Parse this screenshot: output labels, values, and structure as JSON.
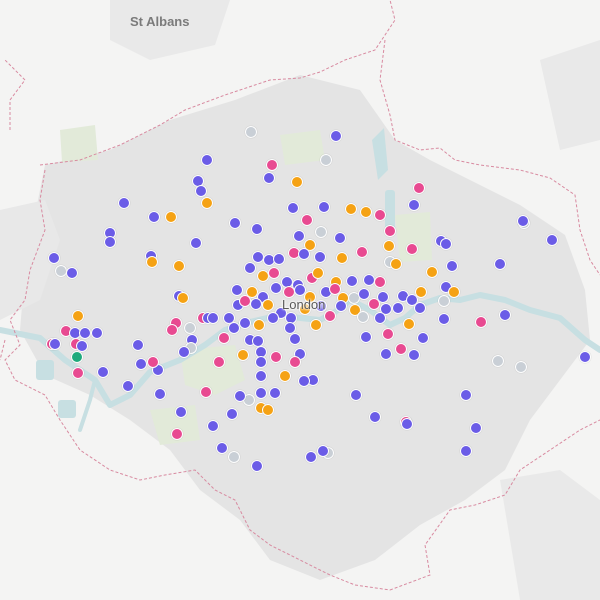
{
  "map": {
    "labels": {
      "city_north": "St Albans",
      "city_center": "London"
    },
    "colors": {
      "background": "#f4f4f3",
      "urban": "#e3e3e3",
      "water": "#c7dfe2",
      "park": "#e4ecde",
      "boundary": "#d88aa0",
      "label": "#7b7b7b"
    },
    "marker_colors": {
      "purple": "#6b5ce7",
      "pink": "#e84a91",
      "orange": "#f5a214",
      "gray": "#c9cfd6",
      "green": "#1eaa7c"
    }
  }
}
